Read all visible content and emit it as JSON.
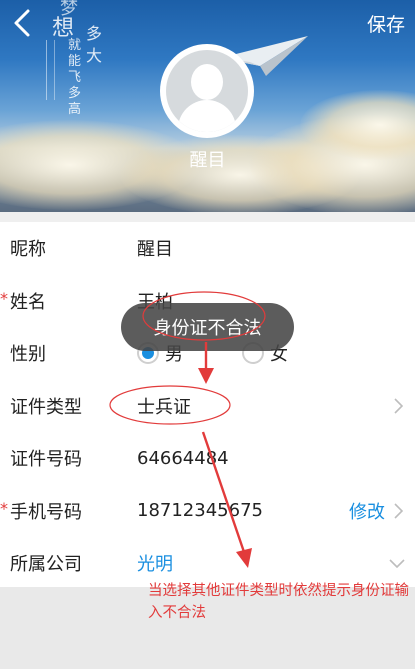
{
  "header": {
    "save_label": "保存",
    "nickname_display": "醒目",
    "deco_text": [
      "梦",
      "想",
      "多",
      "大",
      "就",
      "能",
      "飞",
      "多",
      "高"
    ]
  },
  "form": {
    "rows": [
      {
        "label": "昵称",
        "value": "醒目",
        "required": false
      },
      {
        "label": "姓名",
        "value": "王柏",
        "required": true
      },
      {
        "label": "性别",
        "options": [
          "男",
          "女"
        ],
        "selected": "男",
        "required": false
      },
      {
        "label": "证件类型",
        "value": "士兵证",
        "required": false
      },
      {
        "label": "证件号码",
        "value": "64664484",
        "required": false
      },
      {
        "label": "手机号码",
        "value": "18712345675",
        "action": "修改",
        "required": true
      },
      {
        "label": "所属公司",
        "value": "光明",
        "required": false
      }
    ]
  },
  "toast": {
    "message": "身份证不合法"
  },
  "annotation": {
    "note": "当选择其他证件类型时依然提示身份证输入不合法",
    "color": "#e23b3b"
  },
  "colors": {
    "accent": "#1a8fe0",
    "required": "#e23b3b"
  }
}
